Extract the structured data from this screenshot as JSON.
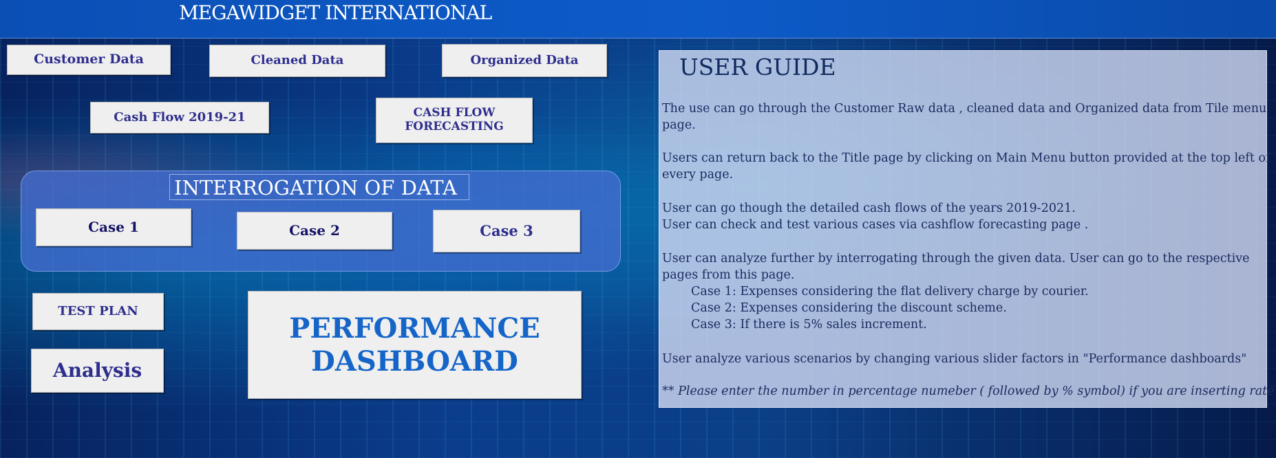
{
  "app": {
    "title": "MEGAWIDGET INTERNATIONAL"
  },
  "nav": {
    "customer_data": "Customer Data",
    "cleaned_data": "Cleaned Data",
    "organized_data": "Organized Data",
    "cash_flow": "Cash Flow 2019-21",
    "cash_flow_forecasting": "CASH FLOW FORECASTING",
    "test_plan": "TEST PLAN",
    "analysis": "Analysis",
    "performance_dashboard": "PERFORMANCE DASHBOARD"
  },
  "interrogation": {
    "title": "INTERROGATION OF DATA",
    "case1": "Case 1",
    "case2": "Case 2",
    "case3": "Case 3"
  },
  "guide": {
    "title": "USER GUIDE",
    "p1a": "The use can go through the Customer Raw data , cleaned data and Organized data from Tile menu",
    "p1b": "page.",
    "p2a": "Users can return back to the Title page by clicking on Main Menu button provided at the top left of",
    "p2b": "every page.",
    "p3a": "User can go though the detailed cash flows of the years 2019-2021.",
    "p3b": "User can check and test various cases via cashflow forecasting page .",
    "p4a": "User can analyze further by interrogating through the given data. User can go to the respective",
    "p4b": "pages from this page.",
    "case1": "Case 1: Expenses considering the flat delivery charge by courier.",
    "case2": "Case 2:  Expenses considering the discount scheme.",
    "case3": "Case 3: If there is 5% sales increment.",
    "p5": "User analyze various scenarios by changing various slider factors in  \"Performance dashboards\"",
    "note": "** Please enter the number in percentage numeber ( followed by % symbol) if you are inserting rate"
  },
  "colors": {
    "tile_text": "#2e2e8e",
    "dashboard_text": "#1565c8",
    "panel_blue": "#466ed2",
    "guide_bg": "#cdd7f0"
  }
}
